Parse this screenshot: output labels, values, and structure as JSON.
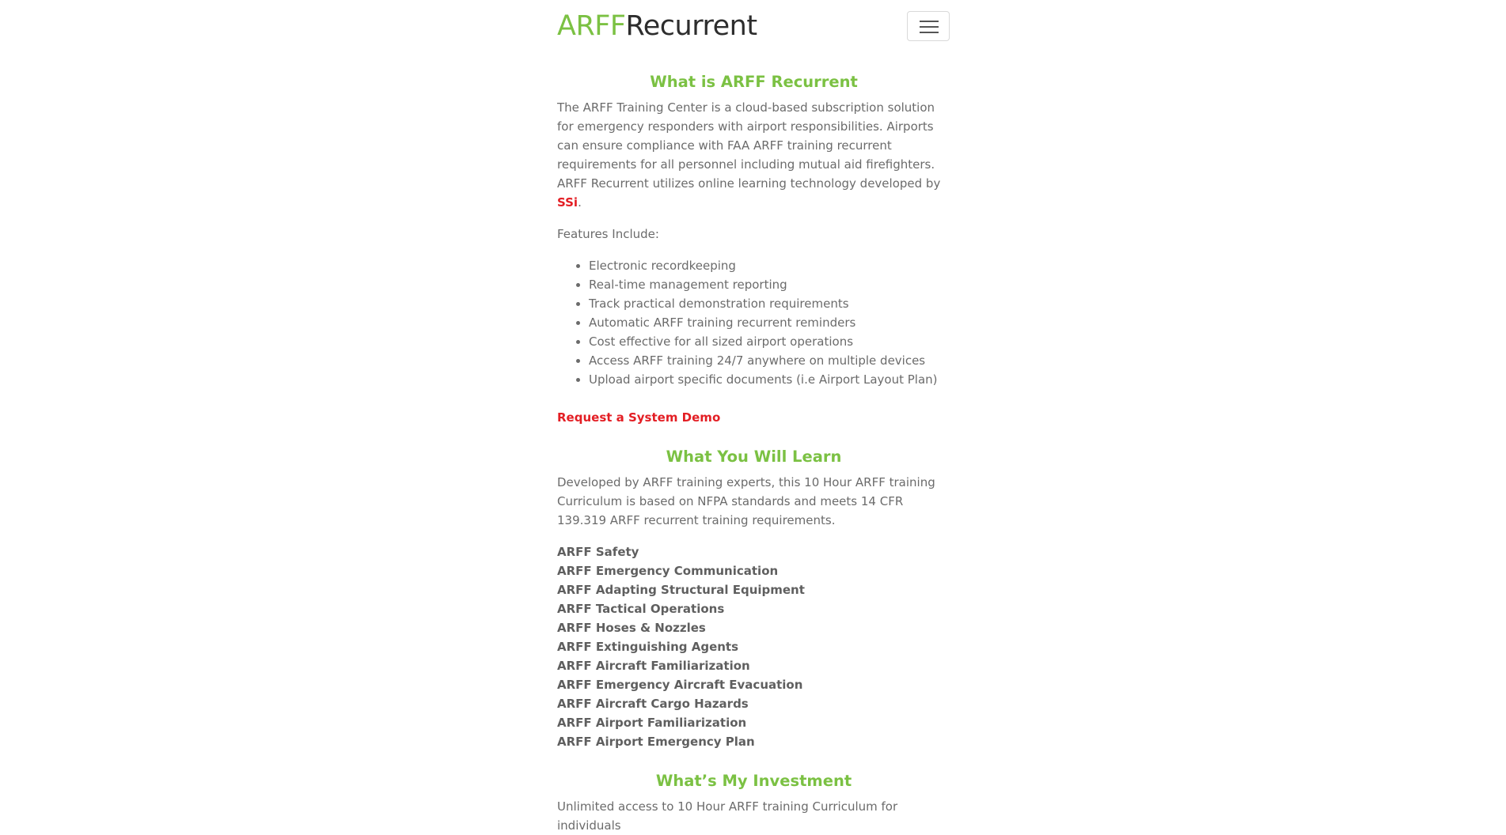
{
  "header": {
    "logo_part1": "ARFF",
    "logo_part2": "Recurrent",
    "menu_icon": "hamburger-menu-icon"
  },
  "colors": {
    "accent_green": "#7bc143",
    "link_red": "#e31e24",
    "body_text": "#6b6b6b"
  },
  "about": {
    "heading": "What is ARFF Recurrent",
    "intro_text": "The ARFF Training Center is a cloud-based subscription solution for emergency responders with airport responsibilities. Airports can ensure compliance with FAA ARFF training recurrent requirements for all personnel including mutual aid firefighters. ARFF Recurrent utilizes online learning technology developed by ",
    "brand_link": "SSi",
    "intro_end": ".",
    "features_label": "Features Include:",
    "features": [
      "Electronic recordkeeping",
      "Real-time management reporting",
      "Track practical demonstration requirements",
      "Automatic ARFF training recurrent reminders",
      "Cost effective for all sized airport operations",
      "Access ARFF training 24/7 anywhere on multiple devices",
      "Upload airport specific documents (i.e Airport Layout Plan)"
    ],
    "demo_link": "Request a System Demo"
  },
  "learn": {
    "heading": "What You Will Learn",
    "intro_text": "Developed by ARFF training experts, this 10 Hour ARFF training Curriculum is based on NFPA standards and meets 14 CFR 139.319 ARFF recurrent training requirements.",
    "modules": [
      "ARFF Safety",
      "ARFF Emergency Communication",
      "ARFF Adapting Structural Equipment",
      "ARFF Tactical Operations",
      "ARFF Hoses & Nozzles",
      "ARFF Extinguishing Agents",
      "ARFF Aircraft Familiarization",
      "ARFF Emergency Aircraft Evacuation",
      "ARFF Aircraft Cargo Hazards",
      "ARFF Airport Familiarization",
      "ARFF Airport Emergency Plan"
    ]
  },
  "investment": {
    "heading": "What’s My Investment",
    "intro_text": "Unlimited access to 10 Hour ARFF training Curriculum for individuals"
  }
}
